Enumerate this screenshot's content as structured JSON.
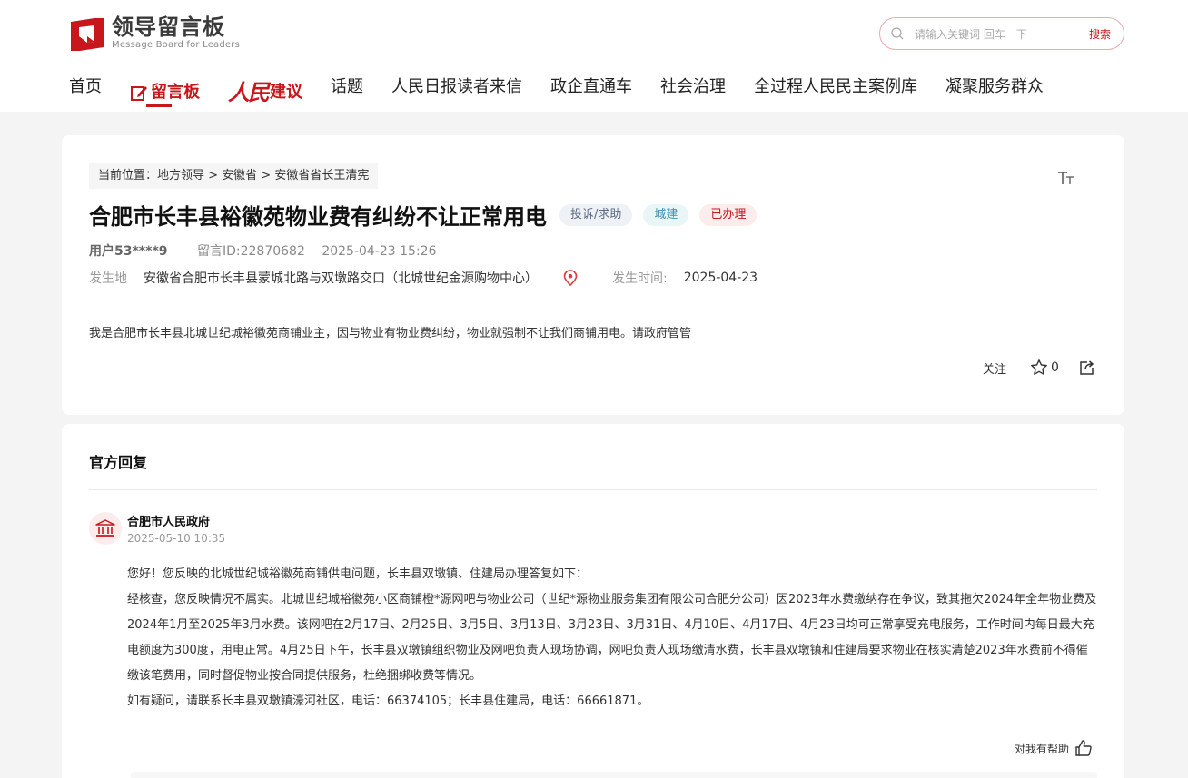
{
  "header": {
    "logo_cn": "领导留言板",
    "logo_en": "Message Board for Leaders",
    "search_placeholder": "请输入关键词 回车一下",
    "search_button": "搜索"
  },
  "nav": {
    "home": "首页",
    "board": "留言板",
    "rm_script": "人民",
    "rm_suffix": "建议",
    "items": [
      "话题",
      "人民日报读者来信",
      "政企直通车",
      "社会治理",
      "全过程人民民主案例库",
      "凝聚服务群众"
    ]
  },
  "message": {
    "breadcrumb": "当前位置：地方领导 > 安徽省 > 安徽省省长王清宪",
    "font_toggle": "TT",
    "title": "合肥市长丰县裕徽苑物业费有纠纷不让正常用电",
    "tags": {
      "type": "投诉/求助",
      "field": "城建",
      "status": "已办理"
    },
    "user": "用户53****9",
    "message_id": "留言ID:22870682",
    "posted_at": "2025-04-23 15:26",
    "location_label": "发生地",
    "location": "安徽省合肥市长丰县蒙城北路与双墩路交口（北城世纪金源购物中心）",
    "time_label": "发生时间:",
    "time": "2025-04-23",
    "content": "我是合肥市长丰县北城世纪城裕徽苑商铺业主，因与物业有物业费纠纷，物业就强制不让我们商铺用电。请政府管管",
    "follow": "关注",
    "favorites": "0"
  },
  "reply": {
    "section_title": "官方回复",
    "org": "合肥市人民政府",
    "time": "2025-05-10 10:35",
    "paragraphs": [
      "您好！您反映的北城世纪城裕徽苑商铺供电问题，长丰县双墩镇、住建局办理答复如下：",
      "经核查，您反映情况不属实。北城世纪城裕徽苑小区商铺橙*源网吧与物业公司（世纪*源物业服务集团有限公司合肥分公司）因2023年水费缴纳存在争议，致其拖欠2024年全年物业费及2024年1月至2025年3月水费。该网吧在2月17日、2月25日、3月5日、3月13日、3月23日、3月31日、4月10日、4月17日、4月23日均可正常享受充电服务，工作时间内每日最大充电额度为300度，用电正常。4月25日下午，长丰县双墩镇组织物业及网吧负责人现场协调，网吧负责人现场缴清水费，长丰县双墩镇和住建局要求物业在核实清楚2023年水费前不得催缴该笔费用，同时督促物业按合同提供服务，杜绝捆绑收费等情况。",
      "如有疑问，请联系长丰县双墩镇濠河社区，电话：66374105；长丰县住建局，电话：66661871。"
    ],
    "helpful": "对我有帮助"
  },
  "colors": {
    "brand_red": "#c8161d"
  }
}
